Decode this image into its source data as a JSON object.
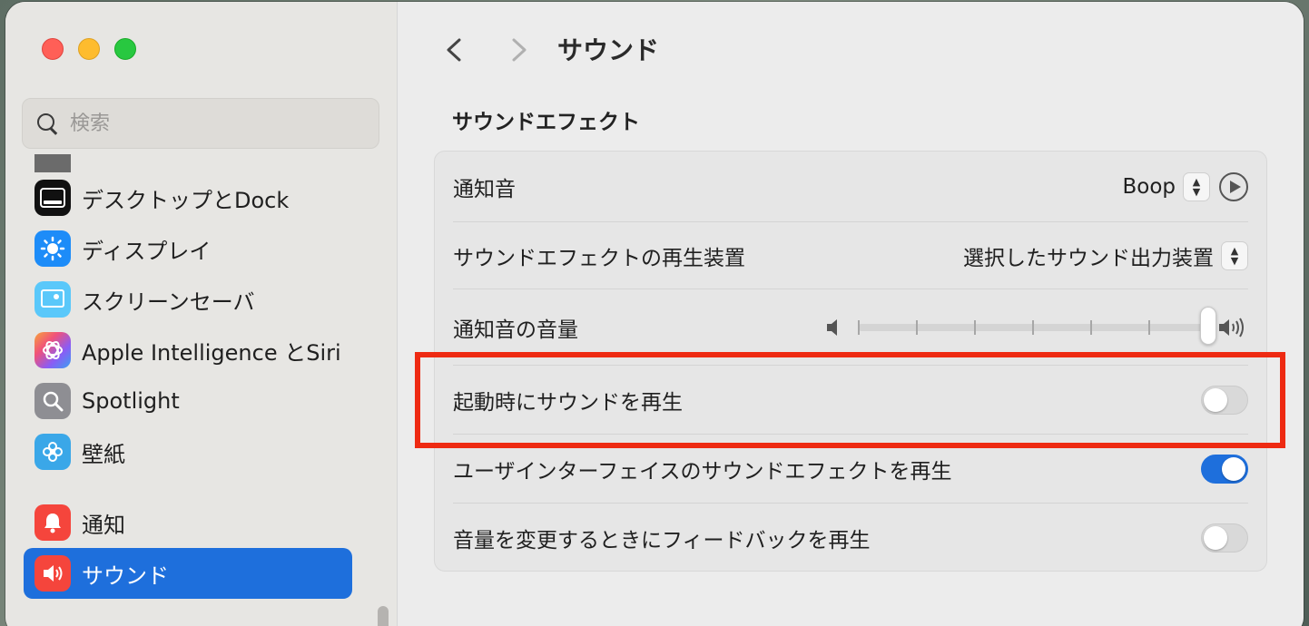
{
  "search": {
    "placeholder": "検索"
  },
  "sidebar": {
    "items": [
      {
        "label": "デスクトップとDock",
        "icon": "dock-icon",
        "color": "#111111"
      },
      {
        "label": "ディスプレイ",
        "icon": "display-brightness-icon",
        "color": "#1d8cf8"
      },
      {
        "label": "スクリーンセーバ",
        "icon": "screensaver-icon",
        "color": "#5ac8fa"
      },
      {
        "label": "Apple Intelligence とSiri",
        "icon": "siri-icon",
        "color": "#b45cf0"
      },
      {
        "label": "Spotlight",
        "icon": "spotlight-icon",
        "color": "#8e8e93"
      },
      {
        "label": "壁紙",
        "icon": "wallpaper-icon",
        "color": "#3aa7e8"
      },
      {
        "label": "通知",
        "icon": "notification-bell-icon",
        "color": "#f5453c"
      },
      {
        "label": "サウンド",
        "icon": "speaker-icon",
        "color": "#f5453c",
        "active": true
      }
    ]
  },
  "header": {
    "title": "サウンド"
  },
  "section": {
    "title": "サウンドエフェクト",
    "rows": [
      {
        "label": "通知音",
        "value": "Boop"
      },
      {
        "label": "サウンドエフェクトの再生装置",
        "value": "選択したサウンド出力装置"
      },
      {
        "label": "通知音の音量",
        "volume_fraction": 0.99
      },
      {
        "label": "起動時にサウンドを再生",
        "toggle": false
      },
      {
        "label": "ユーザインターフェイスのサウンドエフェクトを再生",
        "toggle": true
      },
      {
        "label": "音量を変更するときにフィードバックを再生",
        "toggle": false
      }
    ]
  },
  "colors": {
    "accent": "#1e6fdc",
    "highlight": "#ee2a12"
  }
}
